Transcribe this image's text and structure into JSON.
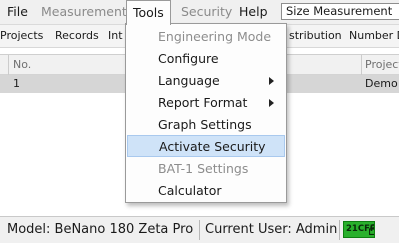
{
  "menubar": {
    "items": [
      {
        "label": "File",
        "enabled": true
      },
      {
        "label": "Measurement",
        "enabled": false
      },
      {
        "label": "Tools",
        "enabled": true,
        "active": true
      },
      {
        "label": "Security",
        "enabled": false
      },
      {
        "label": "Help",
        "enabled": true
      }
    ],
    "measurement_type": "Size Measurement"
  },
  "tabs": [
    "Projects",
    "Records",
    "Int",
    "stribution",
    "Number D"
  ],
  "grid": {
    "columns": [
      "No.",
      "Project"
    ],
    "rows": [
      {
        "no": "1",
        "project": "Demo"
      }
    ]
  },
  "tools_menu": {
    "items": [
      {
        "label": "Engineering Mode",
        "enabled": false,
        "submenu": false
      },
      {
        "label": "Configure",
        "enabled": true,
        "submenu": false
      },
      {
        "label": "Language",
        "enabled": true,
        "submenu": true
      },
      {
        "label": "Report Format",
        "enabled": true,
        "submenu": true
      },
      {
        "label": "Graph Settings",
        "enabled": true,
        "submenu": false
      },
      {
        "label": "Activate Security",
        "enabled": true,
        "submenu": false,
        "highlighted": true
      },
      {
        "label": "BAT-1 Settings",
        "enabled": false,
        "submenu": false
      },
      {
        "label": "Calculator",
        "enabled": true,
        "submenu": false
      }
    ]
  },
  "statusbar": {
    "model": "Model: BeNano 180 Zeta Pro",
    "user": "Current User: Admin",
    "cfr_badge": "21CFR",
    "cfr_icon": "unlock-icon"
  },
  "colors": {
    "menu_highlight": "#cfe3f8",
    "disabled_text": "#8a8a8a",
    "cfr_badge_bg": "#29b02c",
    "selected_row_bg": "#d6d6d6"
  }
}
